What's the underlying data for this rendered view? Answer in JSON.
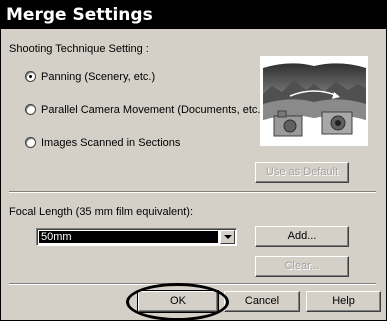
{
  "dialog": {
    "title": "Merge Settings",
    "shooting_label": "Shooting Technique Setting :",
    "radios": [
      {
        "label": "Panning (Scenery, etc.)",
        "selected": true
      },
      {
        "label": "Parallel Camera Movement (Documents, etc.)",
        "selected": false
      },
      {
        "label": "Images Scanned in Sections",
        "selected": false
      }
    ],
    "use_as_default": "Use as Default",
    "focal_label": "Focal Length (35 mm film equivalent):",
    "focal_value": "50mm",
    "add": "Add...",
    "clear": "Clear...",
    "ok": "OK",
    "cancel": "Cancel",
    "help": "Help"
  },
  "icons": {
    "illustration": "panorama-camera-illustration",
    "combo_arrow": "chevron-down-icon"
  }
}
